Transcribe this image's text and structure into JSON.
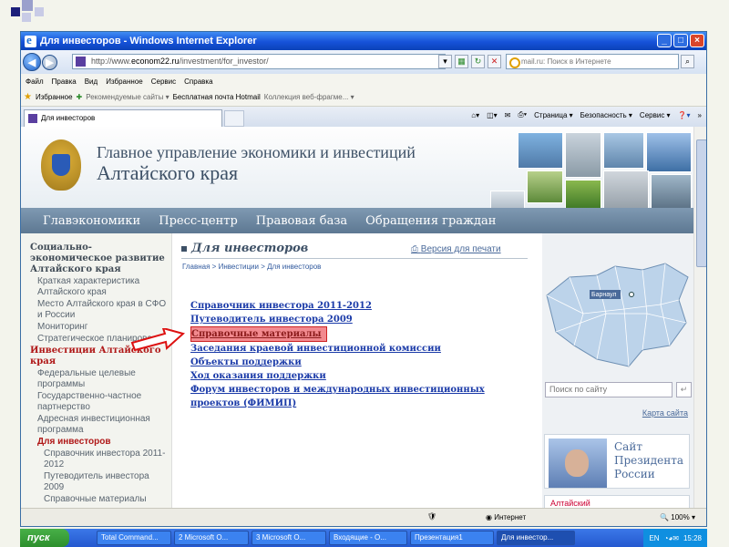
{
  "window": {
    "title": "Для инвесторов - Windows Internet Explorer"
  },
  "address": {
    "prefix": "http://www.",
    "domain": "econom22.ru",
    "path": "/investment/for_investor/"
  },
  "search": {
    "placeholder": "mail.ru: Поиск в Интернете"
  },
  "menu": [
    "Файл",
    "Правка",
    "Вид",
    "Избранное",
    "Сервис",
    "Справка"
  ],
  "favorites": {
    "label": "Избранное",
    "items": [
      "Рекомендуемые сайты ▾",
      "Бесплатная почта Hotmail",
      "Коллекция веб-фрагме... ▾"
    ]
  },
  "tab": {
    "label": "Для инвесторов"
  },
  "commands": [
    "Страница ▾",
    "Безопасность ▾",
    "Сервис ▾"
  ],
  "site": {
    "title_line1": "Главное управление экономики и инвестиций",
    "title_line2": "Алтайского края",
    "nav": [
      "Главэкономики",
      "Пресс-центр",
      "Правовая база",
      "Обращения граждан"
    ],
    "left_menu": [
      {
        "text": "Социально-экономическое развитие Алтайского края",
        "level": 0
      },
      {
        "text": "Краткая характеристика Алтайского края",
        "level": 1
      },
      {
        "text": "Место Алтайского края в СФО и России",
        "level": 1
      },
      {
        "text": "Мониторинг",
        "level": 1
      },
      {
        "text": "Стратегическое планирование",
        "level": 1
      },
      {
        "text": "Инвестиции Алтайского края",
        "level": 0,
        "active": true
      },
      {
        "text": "Федеральные целевые программы",
        "level": 1
      },
      {
        "text": "Государственно-частное партнерство",
        "level": 1
      },
      {
        "text": "Адресная инвестиционная программа",
        "level": 1
      },
      {
        "text": "Для инвесторов",
        "level": 1,
        "active": true
      },
      {
        "text": "Справочник инвестора 2011-2012",
        "level": 2
      },
      {
        "text": "Путеводитель инвестора 2009",
        "level": 2
      },
      {
        "text": "Справочные материалы",
        "level": 2
      }
    ],
    "page_title": "Для инвесторов",
    "print_label": "Версия для печати",
    "breadcrumb": "Главная > Инвестиции > Для инвесторов",
    "links": [
      "Справочник инвестора 2011-2012",
      "Путеводитель инвестора 2009",
      "Справочные материалы",
      "Заседания краевой инвестиционной комиссии",
      "Объекты поддержки",
      "Ход оказания поддержки",
      "Форум инвесторов и международных инвестиционных проектов (ФИМИП)"
    ],
    "highlighted_link_index": 2,
    "map_label": "Барнаул",
    "site_search_placeholder": "Поиск по сайту",
    "site_search_go": "↵",
    "sitemap": "Карта сайта",
    "president_text": "Сайт Президента России",
    "banner_text": "Алтайский"
  },
  "status": {
    "zone": "Интернет",
    "zoom": "100%"
  },
  "taskbar": {
    "start": "пуск",
    "items": [
      "Total Command...",
      "2 Microsoft O...",
      "3 Microsoft O...",
      "Входящие - O...",
      "Презентация1",
      "Для инвестор..."
    ],
    "lang": "EN",
    "time": "15:28"
  },
  "colors": {
    "titlebar": "#1652d9",
    "site_nav": "#6a8499",
    "link": "#1a3aa8",
    "active_menu": "#b01818",
    "highlight": "#f28a8f"
  }
}
